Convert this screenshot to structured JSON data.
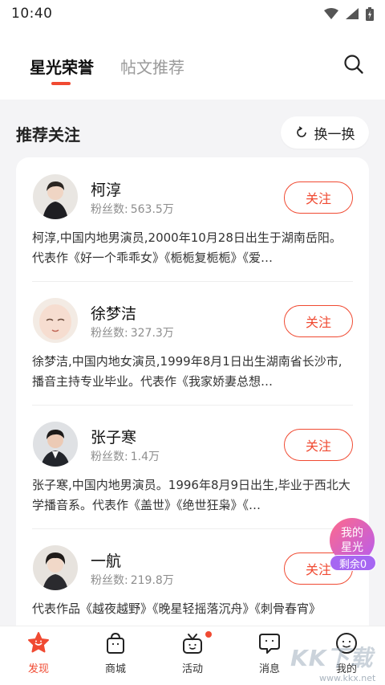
{
  "status_bar": {
    "time": "10:40"
  },
  "header": {
    "tabs": [
      {
        "label": "星光荣誉",
        "active": true
      },
      {
        "label": "帖文推荐",
        "active": false
      }
    ],
    "accent_color": "#f04a32"
  },
  "section": {
    "title": "推荐关注",
    "refresh_label": "换一换"
  },
  "recommendations": [
    {
      "name": "柯淳",
      "fans_label": "粉丝数:",
      "fans_value": "563.5万",
      "follow_label": "关注",
      "description": "柯淳,中国内地男演员,2000年10月28日出生于湖南岳阳。代表作《好一个乖乖女》《栀栀复栀栀》《爱…"
    },
    {
      "name": "徐梦洁",
      "fans_label": "粉丝数:",
      "fans_value": "327.3万",
      "follow_label": "关注",
      "description": "徐梦洁,中国内地女演员,1999年8月1日出生湖南省长沙市,播音主持专业毕业。代表作《我家娇妻总想…"
    },
    {
      "name": "张子寒",
      "fans_label": "粉丝数:",
      "fans_value": "1.4万",
      "follow_label": "关注",
      "description": "张子寒,中国内地男演员。1996年8月9日出生,毕业于西北大学播音系。代表作《盖世》《绝世狂枭》《…"
    },
    {
      "name": "一航",
      "fans_label": "粉丝数:",
      "fans_value": "219.8万",
      "follow_label": "关注",
      "description": "代表作品《越夜越野》《晚星轻摇落沉舟》《刺骨春宵》"
    }
  ],
  "floating_badge": {
    "line1": "我的",
    "line2": "星光",
    "remaining": "剩余0"
  },
  "bottom_nav": [
    {
      "label": "发现",
      "icon": "discover-star-icon",
      "active": true
    },
    {
      "label": "商城",
      "icon": "shopping-bag-icon",
      "active": false
    },
    {
      "label": "活动",
      "icon": "activity-tv-icon",
      "active": false,
      "dot": true
    },
    {
      "label": "消息",
      "icon": "message-bubble-icon",
      "active": false
    },
    {
      "label": "我的",
      "icon": "profile-face-icon",
      "active": false
    }
  ],
  "watermark": {
    "brand": "KK下载",
    "url": "www.kkx.net"
  }
}
